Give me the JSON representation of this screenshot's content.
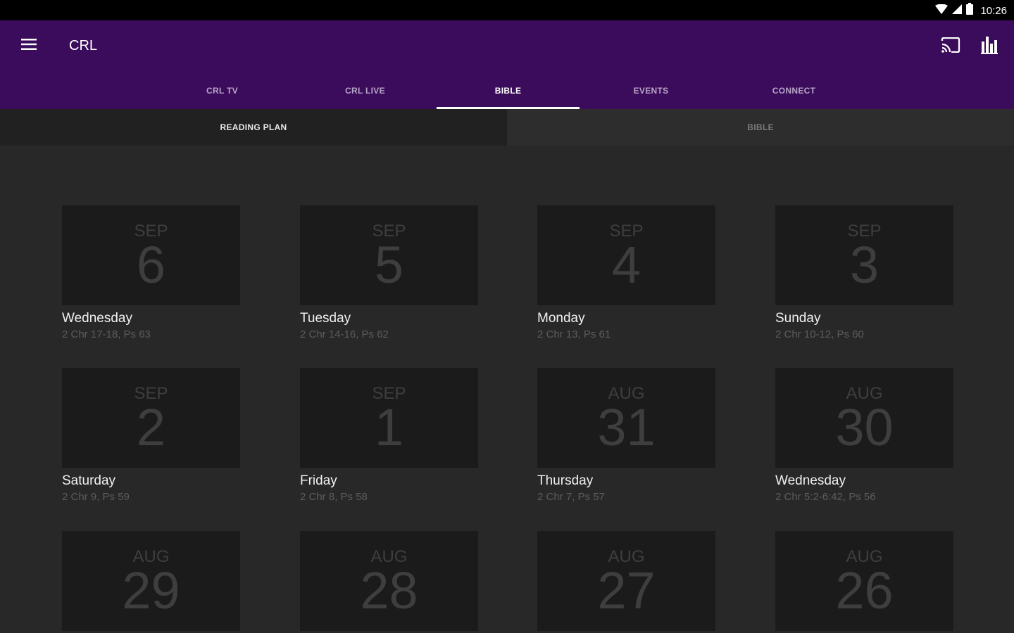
{
  "status_bar": {
    "time": "10:26"
  },
  "app_bar": {
    "title": "CRL"
  },
  "tabs": [
    {
      "label": "CRL TV",
      "active": false
    },
    {
      "label": "CRL LIVE",
      "active": false
    },
    {
      "label": "BIBLE",
      "active": true
    },
    {
      "label": "EVENTS",
      "active": false
    },
    {
      "label": "CONNECT",
      "active": false
    }
  ],
  "subtabs": [
    {
      "label": "READING PLAN",
      "active": true
    },
    {
      "label": "BIBLE",
      "active": false
    }
  ],
  "readings": [
    {
      "month": "SEP",
      "day": "6",
      "weekday": "Wednesday",
      "reading": "2 Chr 17-18, Ps 63"
    },
    {
      "month": "SEP",
      "day": "5",
      "weekday": "Tuesday",
      "reading": "2 Chr 14-16, Ps 62"
    },
    {
      "month": "SEP",
      "day": "4",
      "weekday": "Monday",
      "reading": "2 Chr 13, Ps 61"
    },
    {
      "month": "SEP",
      "day": "3",
      "weekday": "Sunday",
      "reading": "2 Chr 10-12, Ps 60"
    },
    {
      "month": "SEP",
      "day": "2",
      "weekday": "Saturday",
      "reading": "2 Chr 9, Ps 59"
    },
    {
      "month": "SEP",
      "day": "1",
      "weekday": "Friday",
      "reading": "2 Chr 8, Ps 58"
    },
    {
      "month": "AUG",
      "day": "31",
      "weekday": "Thursday",
      "reading": "2 Chr 7, Ps 57"
    },
    {
      "month": "AUG",
      "day": "30",
      "weekday": "Wednesday",
      "reading": "2 Chr 5:2-6:42, Ps 56"
    },
    {
      "month": "AUG",
      "day": "29",
      "weekday": "",
      "reading": ""
    },
    {
      "month": "AUG",
      "day": "28",
      "weekday": "",
      "reading": ""
    },
    {
      "month": "AUG",
      "day": "27",
      "weekday": "",
      "reading": ""
    },
    {
      "month": "AUG",
      "day": "26",
      "weekday": "",
      "reading": ""
    }
  ],
  "icons": {
    "menu": "hamburger-menu-icon",
    "cast": "cast-icon",
    "stats": "bar-chart-icon",
    "wifi": "wifi-icon",
    "signal": "cell-signal-icon",
    "battery": "battery-icon"
  },
  "colors": {
    "app_bar": "#3c0c5c",
    "background": "#282828",
    "tile": "#1b1b1b"
  }
}
